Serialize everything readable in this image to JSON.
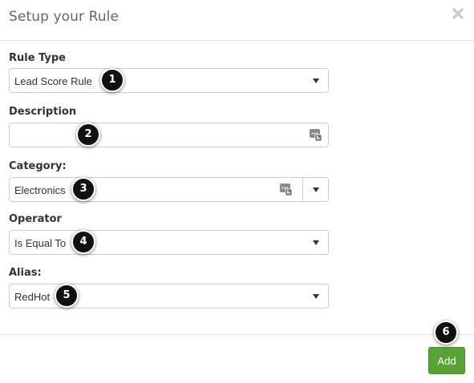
{
  "dialog": {
    "title": "Setup your Rule",
    "close_icon": "close-icon"
  },
  "form": {
    "rule_type": {
      "label": "Rule Type",
      "value": "Lead Score Rule"
    },
    "description": {
      "label": "Description",
      "value": "",
      "icon": "variable-picker-icon"
    },
    "category": {
      "label": "Category:",
      "value": "Electronics",
      "icon": "variable-picker-icon"
    },
    "operator": {
      "label": "Operator",
      "value": "Is Equal To"
    },
    "alias": {
      "label": "Alias:",
      "value": "RedHot"
    }
  },
  "callouts": [
    "1",
    "2",
    "3",
    "4",
    "5",
    "6"
  ],
  "footer": {
    "add_label": "Add"
  },
  "colors": {
    "add_button": "#58a333",
    "callout": "#111111",
    "border": "#cccccc"
  }
}
